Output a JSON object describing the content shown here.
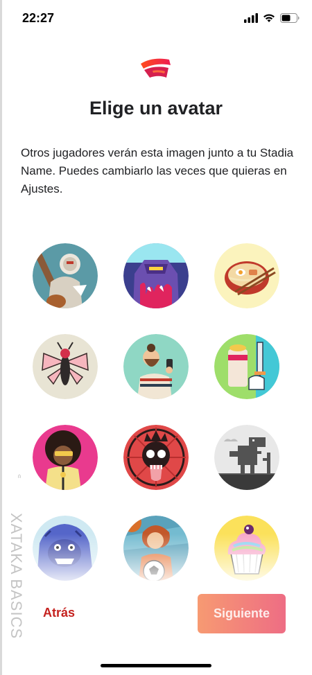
{
  "status_bar": {
    "time": "22:27",
    "icons": [
      "signal-icon",
      "wifi-icon",
      "battery-icon"
    ]
  },
  "logo": {
    "name": "stadia-logo-icon"
  },
  "title": "Elige un avatar",
  "description": "Otros jugadores verán esta imagen junto a tu Stadia Name. Puedes cambiarlo las veces que quieras en Ajustes.",
  "avatars": [
    {
      "name": "avatar-warrior",
      "bg": "#5b9aa6"
    },
    {
      "name": "avatar-robot",
      "bg": "#3b3f8e"
    },
    {
      "name": "avatar-ramen",
      "bg": "#fbf3bd"
    },
    {
      "name": "avatar-insect",
      "bg": "#e8e4d4"
    },
    {
      "name": "avatar-bearded-man",
      "bg": "#8fd7c4"
    },
    {
      "name": "avatar-sword-cup",
      "bg": "#9ede6a"
    },
    {
      "name": "avatar-afro-hero",
      "bg": "#e93a8e"
    },
    {
      "name": "avatar-skull",
      "bg": "#e04848"
    },
    {
      "name": "avatar-dino",
      "bg": "#e8e8e8"
    },
    {
      "name": "avatar-yeti",
      "bg": "#6d7ad8"
    },
    {
      "name": "avatar-soccer-girl",
      "bg": "#5aa2bb"
    },
    {
      "name": "avatar-cupcake",
      "bg": "#fbe15b"
    }
  ],
  "buttons": {
    "back": "Atrás",
    "next": "Siguiente"
  },
  "watermark": {
    "text": "XATAKA BASICS"
  },
  "colors": {
    "back_text": "#c5221f",
    "next_gradient_start": "#f79a72",
    "next_gradient_end": "#ee6d84"
  }
}
